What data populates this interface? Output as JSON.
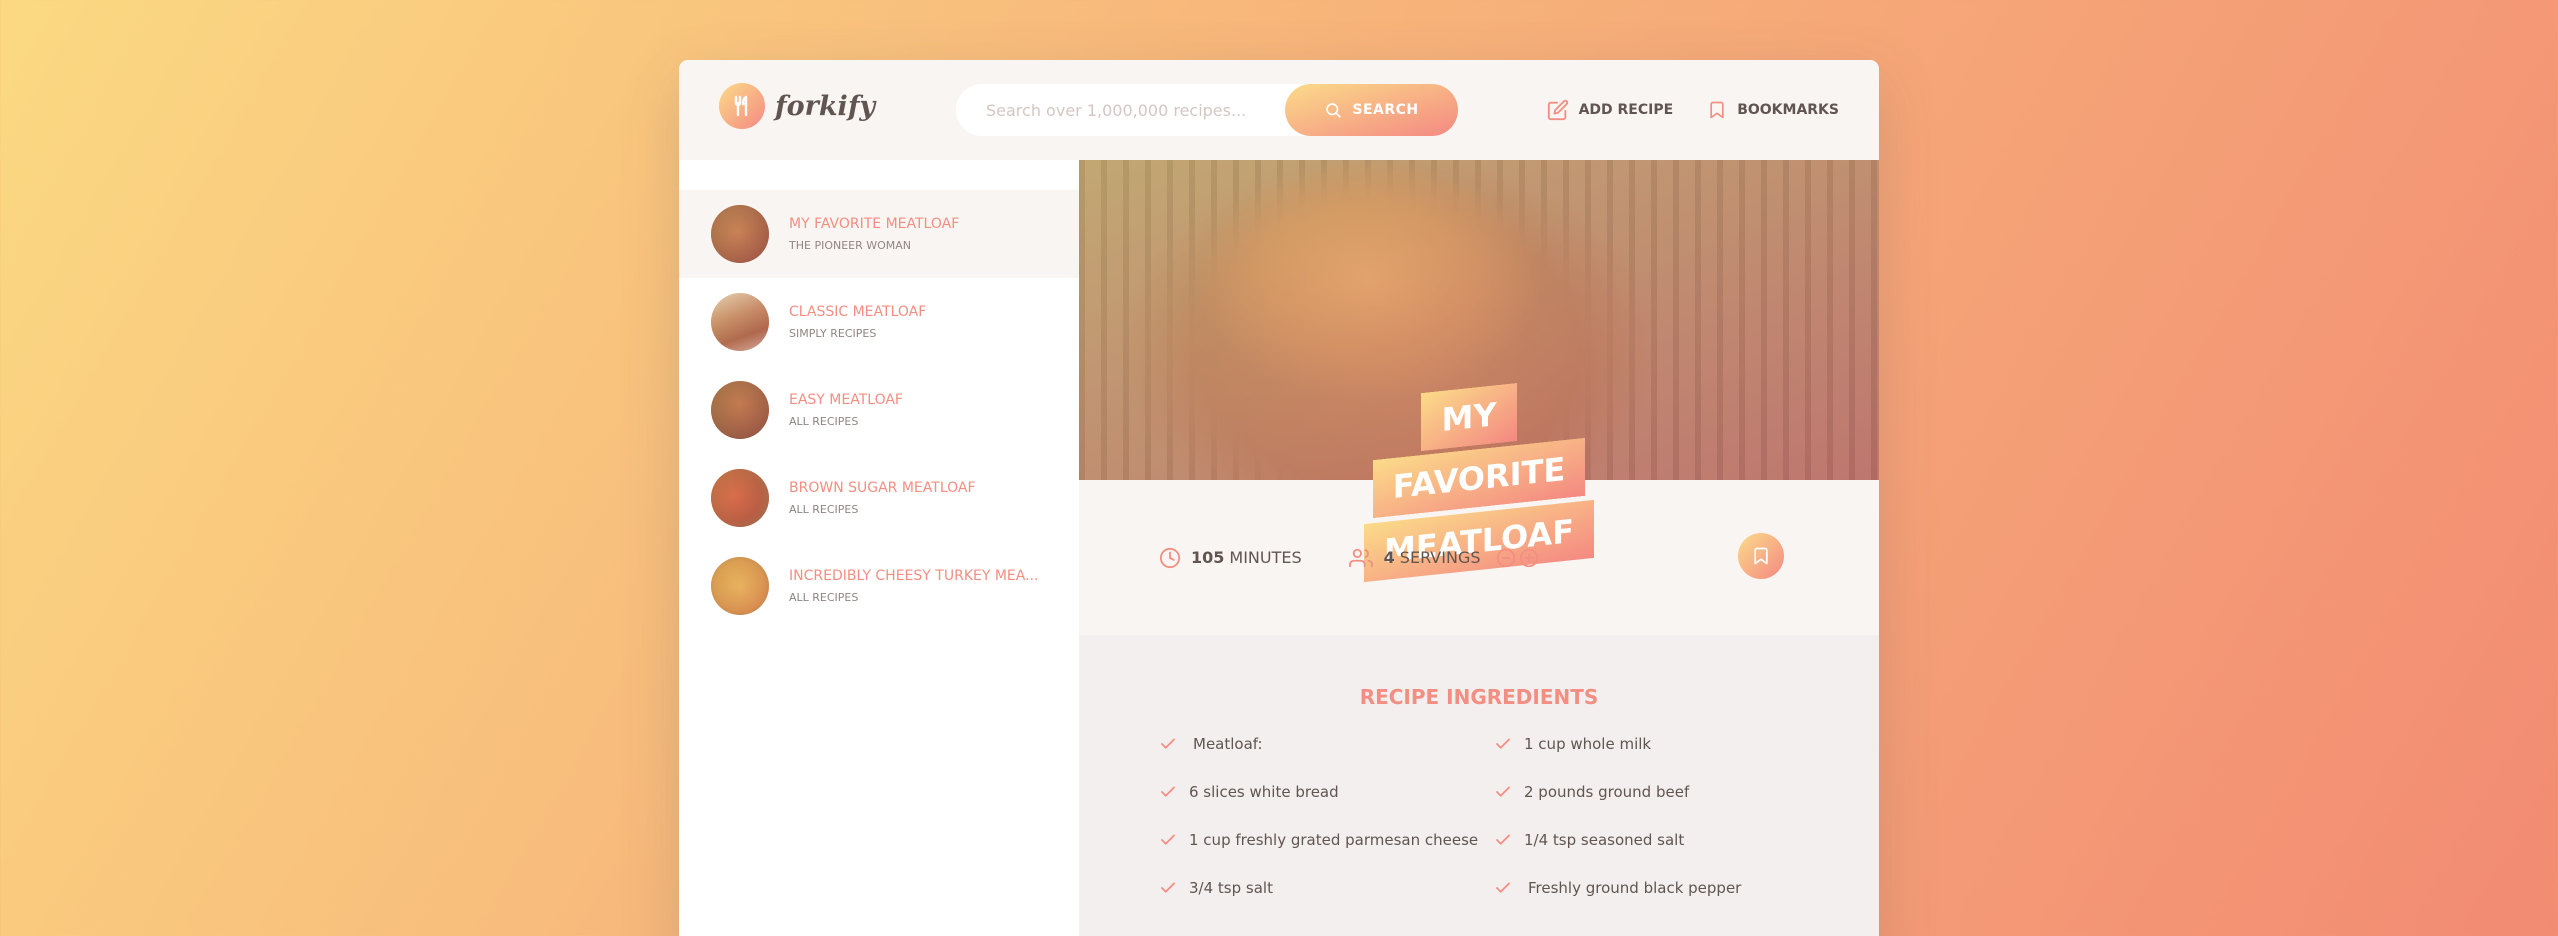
{
  "header": {
    "logo_text": "forkify",
    "search_placeholder": "Search over 1,000,000 recipes...",
    "search_button": "SEARCH",
    "nav": {
      "add_recipe": "ADD RECIPE",
      "bookmarks": "BOOKMARKS"
    }
  },
  "results": [
    {
      "title": "MY FAVORITE MEATLOAF",
      "publisher": "THE PIONEER WOMAN",
      "active": true
    },
    {
      "title": "CLASSIC MEATLOAF",
      "publisher": "SIMPLY RECIPES",
      "active": false
    },
    {
      "title": "EASY MEATLOAF",
      "publisher": "ALL RECIPES",
      "active": false
    },
    {
      "title": "BROWN SUGAR MEATLOAF",
      "publisher": "ALL RECIPES",
      "active": false
    },
    {
      "title": "INCREDIBLY CHEESY TURKEY MEA...",
      "publisher": "ALL RECIPES",
      "active": false
    }
  ],
  "recipe": {
    "title_line1": "MY FAVORITE",
    "title_line2": "MEATLOAF",
    "minutes": "105",
    "minutes_label": "MINUTES",
    "servings": "4",
    "servings_label": "SERVINGS",
    "ingredients_heading": "RECIPE INGREDIENTS",
    "ingredients": [
      "Meatloaf:",
      "1 cup whole milk",
      "6 slices white bread",
      "2 pounds ground beef",
      "1 cup freshly grated parmesan cheese",
      "1/4 tsp seasoned salt",
      "3/4 tsp salt",
      "Freshly ground black pepper"
    ]
  },
  "colors": {
    "accent": "#f38e82",
    "gradient_start": "#fbdb89",
    "gradient_end": "#f48982",
    "text": "#615551"
  }
}
